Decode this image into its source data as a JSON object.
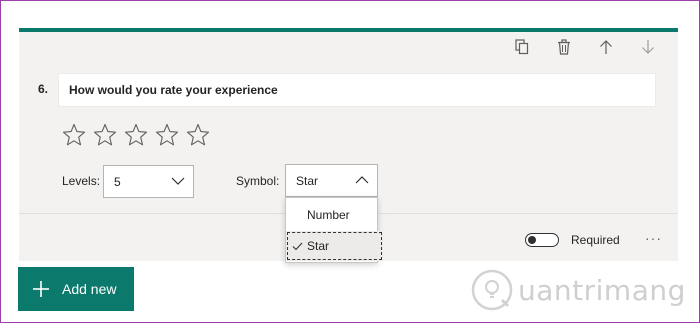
{
  "question": {
    "number": "6.",
    "text": "How would you rate your experience"
  },
  "toolbar": {
    "icons": [
      "copy-icon",
      "trash-icon",
      "arrow-up-icon",
      "arrow-down-icon"
    ]
  },
  "rating": {
    "star_count": 5
  },
  "levels": {
    "label": "Levels:",
    "value": "5"
  },
  "symbol": {
    "label": "Symbol:",
    "value": "Star",
    "options": [
      "Number",
      "Star"
    ],
    "selected": "Star"
  },
  "required": {
    "label": "Required",
    "enabled": false
  },
  "add_new": {
    "label": "Add new"
  },
  "watermark": {
    "text": "uantrimang"
  },
  "colors": {
    "accent": "#0b7a6c",
    "frame": "#9b3fa8",
    "card": "#f3f2f1"
  }
}
